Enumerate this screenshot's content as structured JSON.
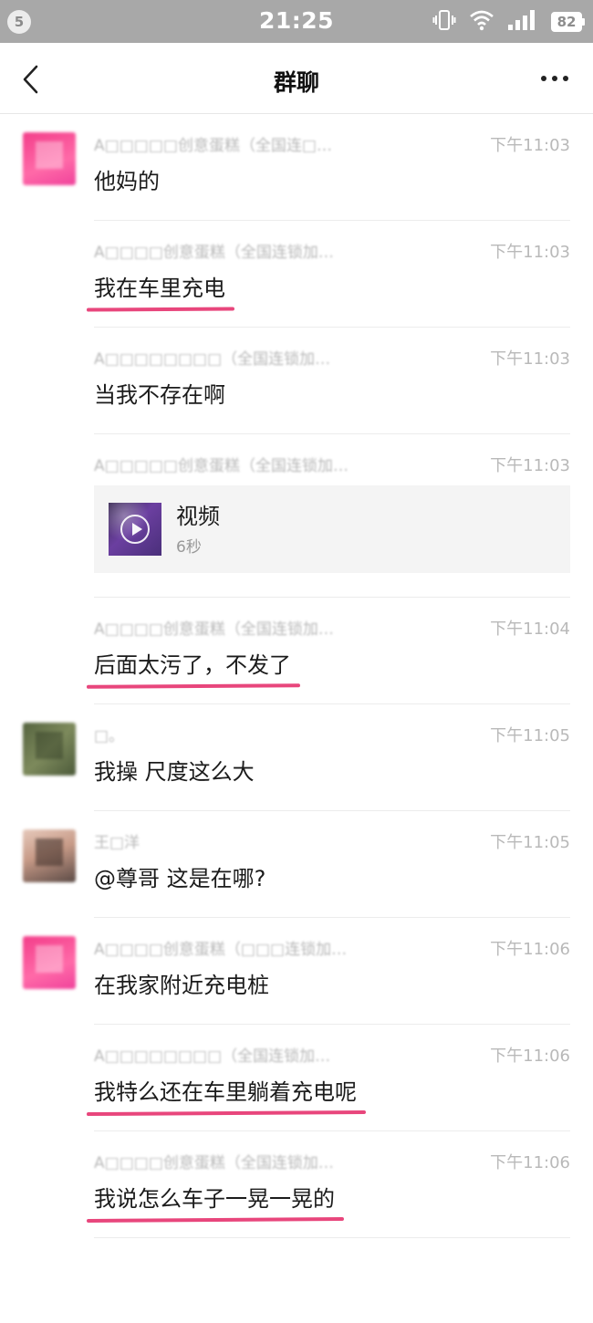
{
  "status_bar": {
    "notification_count": "5",
    "time": "21:25",
    "battery": "82",
    "icons": [
      "vibrate-icon",
      "wifi-icon",
      "signal-icon",
      "battery-icon"
    ]
  },
  "header": {
    "title": "群聊",
    "back_icon": "chevron-left-icon",
    "more_icon": "more-dots-icon"
  },
  "messages": [
    {
      "sender": "A□□□□□创意蛋糕（全国连□…",
      "time": "下午11:03",
      "text": "他妈的",
      "avatar": "pink",
      "underlined": false
    },
    {
      "sender": "A□□□□创意蛋糕（全国连锁加…",
      "time": "下午11:03",
      "text": "我在车里充电",
      "avatar": "",
      "underlined": true
    },
    {
      "sender": "A□□□□□□□□（全国连锁加…",
      "time": "下午11:03",
      "text": "当我不存在啊",
      "avatar": "",
      "underlined": false
    },
    {
      "sender": "A□□□□□创意蛋糕（全国连锁加…",
      "time": "下午11:03",
      "video": {
        "title": "视频",
        "duration": "6秒"
      },
      "avatar": ""
    },
    {
      "sender": "A□□□□创意蛋糕（全国连锁加…",
      "time": "下午11:04",
      "text": "后面太污了，不发了",
      "avatar": "",
      "underlined": true
    },
    {
      "sender": "□。",
      "time": "下午11:05",
      "text": "我操 尺度这么大",
      "avatar": "green",
      "underlined": false
    },
    {
      "sender": "王□洋",
      "time": "下午11:05",
      "text": "@尊哥 这是在哪?",
      "avatar": "photo",
      "underlined": false
    },
    {
      "sender": "A□□□□创意蛋糕（□□□连锁加…",
      "time": "下午11:06",
      "text": "在我家附近充电桩",
      "avatar": "pink",
      "underlined": false
    },
    {
      "sender": "A□□□□□□□□（全国连锁加…",
      "time": "下午11:06",
      "text": "我特么还在车里躺着充电呢",
      "avatar": "",
      "underlined": true
    },
    {
      "sender": "A□□□□创意蛋糕（全国连锁加…",
      "time": "下午11:06",
      "text": "我说怎么车子一晃一晃的",
      "avatar": "",
      "underlined": true
    }
  ],
  "colors": {
    "status_bar_bg": "#a8a8a8",
    "underline": "#e8467c",
    "meta_text": "#b9b9b9"
  }
}
